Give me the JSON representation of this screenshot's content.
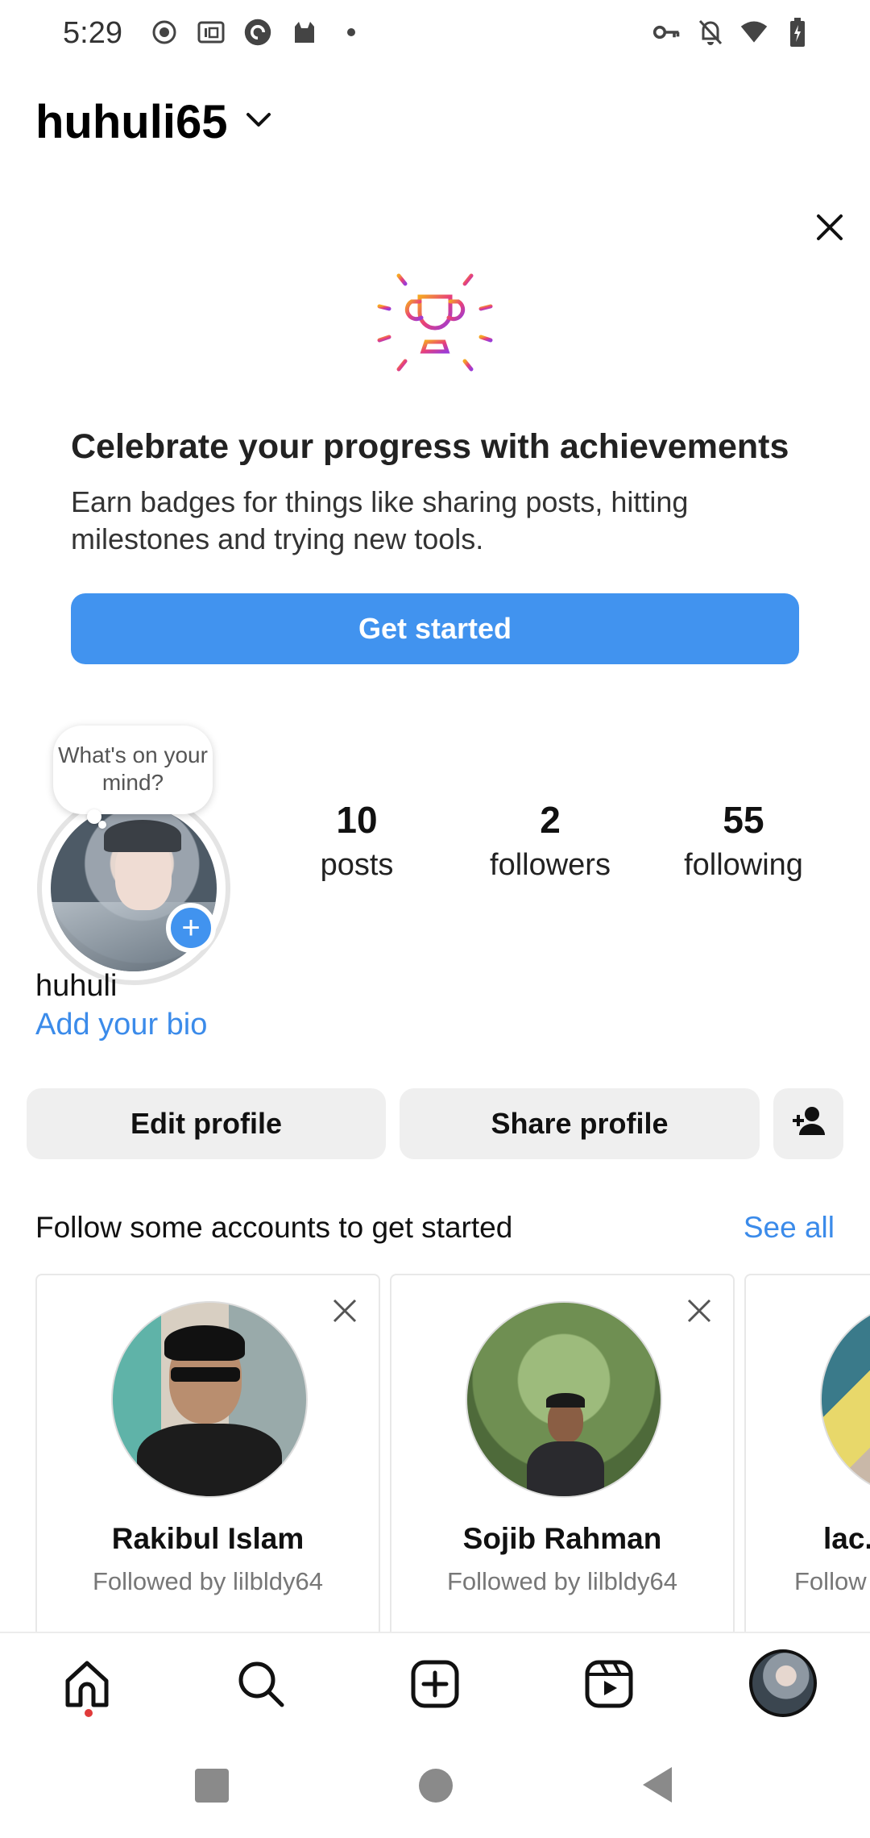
{
  "status_bar": {
    "time": "5:29",
    "left_icons": [
      "record-icon",
      "iqiyi-icon",
      "app-circle-icon",
      "cat-icon",
      "dot-icon"
    ],
    "right_icons": [
      "vpn-key-icon",
      "bell-off-icon",
      "wifi-icon",
      "battery-charging-icon"
    ]
  },
  "header": {
    "username": "huhuli65"
  },
  "achievement": {
    "title": "Celebrate your progress with achievements",
    "text": "Earn badges for things like sharing posts, hitting milestones and trying new tools.",
    "button": "Get started"
  },
  "profile": {
    "note_bubble": "What's on your mind?",
    "stats": [
      {
        "value": "10",
        "label": "posts"
      },
      {
        "value": "2",
        "label": "followers"
      },
      {
        "value": "55",
        "label": "following"
      }
    ],
    "display_name": "huhuli",
    "bio_link": "Add your bio",
    "edit_button": "Edit profile",
    "share_button": "Share profile"
  },
  "suggestions": {
    "title": "Follow some accounts to get started",
    "see_all": "See all",
    "cards": [
      {
        "name": "Rakibul Islam",
        "subtitle": "Followed by lilbldy64"
      },
      {
        "name": "Sojib Rahman",
        "subtitle": "Followed by lilbldy64"
      },
      {
        "name": "lac.",
        "subtitle": "Follow"
      }
    ]
  },
  "colors": {
    "accent": "#4193ef",
    "link": "#3b8bea",
    "button_gray": "#efefef",
    "notification_dot": "#e03a3a"
  },
  "bottom_nav": [
    "home-icon",
    "search-icon",
    "create-icon",
    "reels-icon",
    "profile-avatar"
  ]
}
